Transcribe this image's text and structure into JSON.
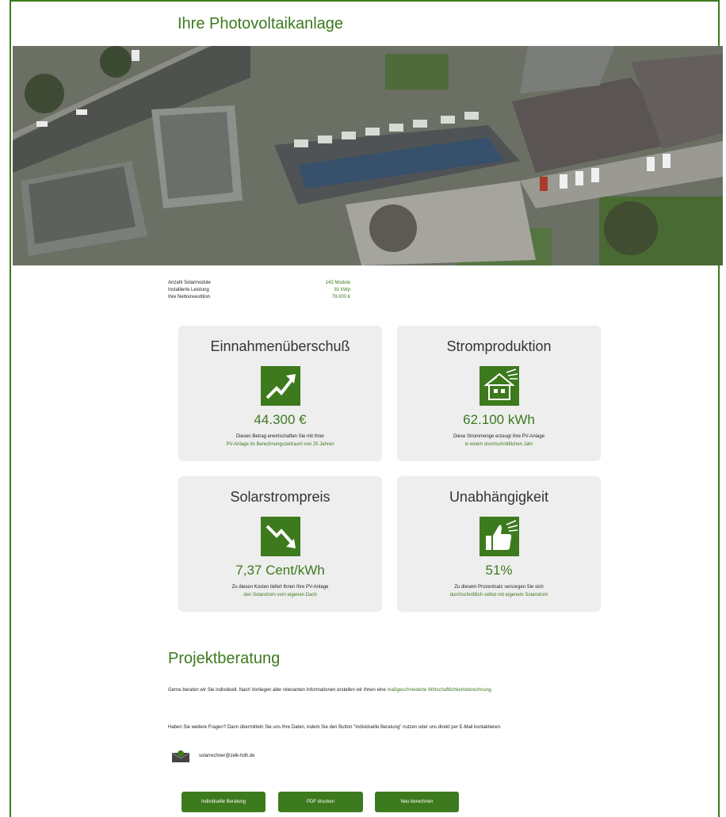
{
  "page": {
    "title": "Ihre Photovoltaikanlage"
  },
  "summary": [
    {
      "label": "Anzahl Solarmodule",
      "value": "143 Module"
    },
    {
      "label": "Installierte Leistung",
      "value": "81 kWp"
    },
    {
      "label": "Ihre Nettoinvestition",
      "value": "79.000 €"
    }
  ],
  "cards": [
    {
      "title": "Einnahmenüberschuß",
      "icon": "trend-up-icon",
      "value": "44.300 €",
      "desc1": "Diesen Betrag erwirtschaften Sie mit Ihrer",
      "desc2": "PV-Anlage im Berechnungszeitraum von 25 Jahren"
    },
    {
      "title": "Stromproduktion",
      "icon": "solar-house-icon",
      "value": "62.100 kWh",
      "desc1": "Diese Strommenge erzeugt Ihre PV-Anlage",
      "desc2": "in einem durchschnittlichen Jahr"
    },
    {
      "title": "Solarstrompreis",
      "icon": "trend-down-icon",
      "value": "7,37 Cent/kWh",
      "desc1": "Zu diesen Kosten liefert Ihnen Ihre PV-Anlage",
      "desc2": "den Solarstrom vom eigenen Dach"
    },
    {
      "title": "Unabhängigkeit",
      "icon": "thumbs-up-icon",
      "value": "51%",
      "desc1": "Zu diesem Prozentsatz versorgen Sie sich",
      "desc2": "durchschnittlich selbst mit eigenem Solarstrom"
    }
  ],
  "consult": {
    "heading": "Projektberatung",
    "para1_a": "Gerne beraten wir Sie individuell. Nach Vorliegen aller relevanten Informationen erstellen wir Ihnen eine",
    "para1_b": "maßgeschneiderte Wirtschaftlichkeitsberechnung.",
    "para2": "Haben Sie weitere Fragen? Dann übermitteln Sie uns Ihre Daten, indem Sie den Button \"Individuelle Beratung\" nutzen oder uns direkt per E-Mail kontaktieren.",
    "email": "solarrechner@zelk-hdh.de"
  },
  "buttons": {
    "individual": "Individuelle Beratung",
    "pdf": "PDF drucken",
    "recalc": "Neu berechnen"
  },
  "colors": {
    "brand": "#3d7a1e",
    "card_bg": "#eeeeee"
  }
}
